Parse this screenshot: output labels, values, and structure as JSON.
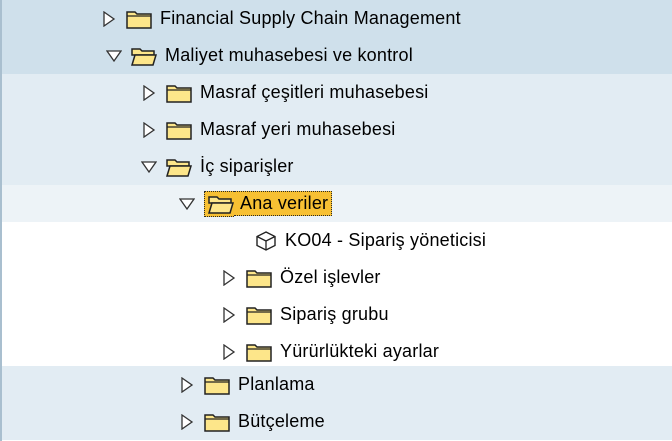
{
  "tree": {
    "items": [
      {
        "label": "Financial Supply Chain Management",
        "state": "collapsed"
      },
      {
        "label": "Maliyet muhasebesi ve kontrol",
        "state": "expanded"
      },
      {
        "label": "Masraf çeşitleri muhasebesi",
        "state": "collapsed"
      },
      {
        "label": "Masraf yeri muhasebesi",
        "state": "collapsed"
      },
      {
        "label": "İç siparişler",
        "state": "expanded"
      },
      {
        "label": "Ana veriler",
        "state": "expanded",
        "selected": true
      },
      {
        "label": "KO04 - Sipariş yöneticisi",
        "type": "transaction"
      },
      {
        "label": "Özel işlevler",
        "state": "collapsed"
      },
      {
        "label": "Sipariş grubu",
        "state": "collapsed"
      },
      {
        "label": "Yürürlükteki ayarlar",
        "state": "collapsed"
      },
      {
        "label": "Planlama",
        "state": "collapsed"
      },
      {
        "label": "Bütçeleme",
        "state": "collapsed"
      }
    ]
  },
  "colors": {
    "band_top": "#cfe0eb",
    "band_mid": "#e2ecf3",
    "band_light": "#edf3f7",
    "folder_fill": "#fde68a",
    "selection": "#f7c033"
  },
  "icons": {
    "collapsed": "triangle-right-icon",
    "expanded": "triangle-down-icon",
    "folder_closed": "folder-icon",
    "folder_open": "folder-open-icon",
    "transaction": "cube-icon"
  }
}
